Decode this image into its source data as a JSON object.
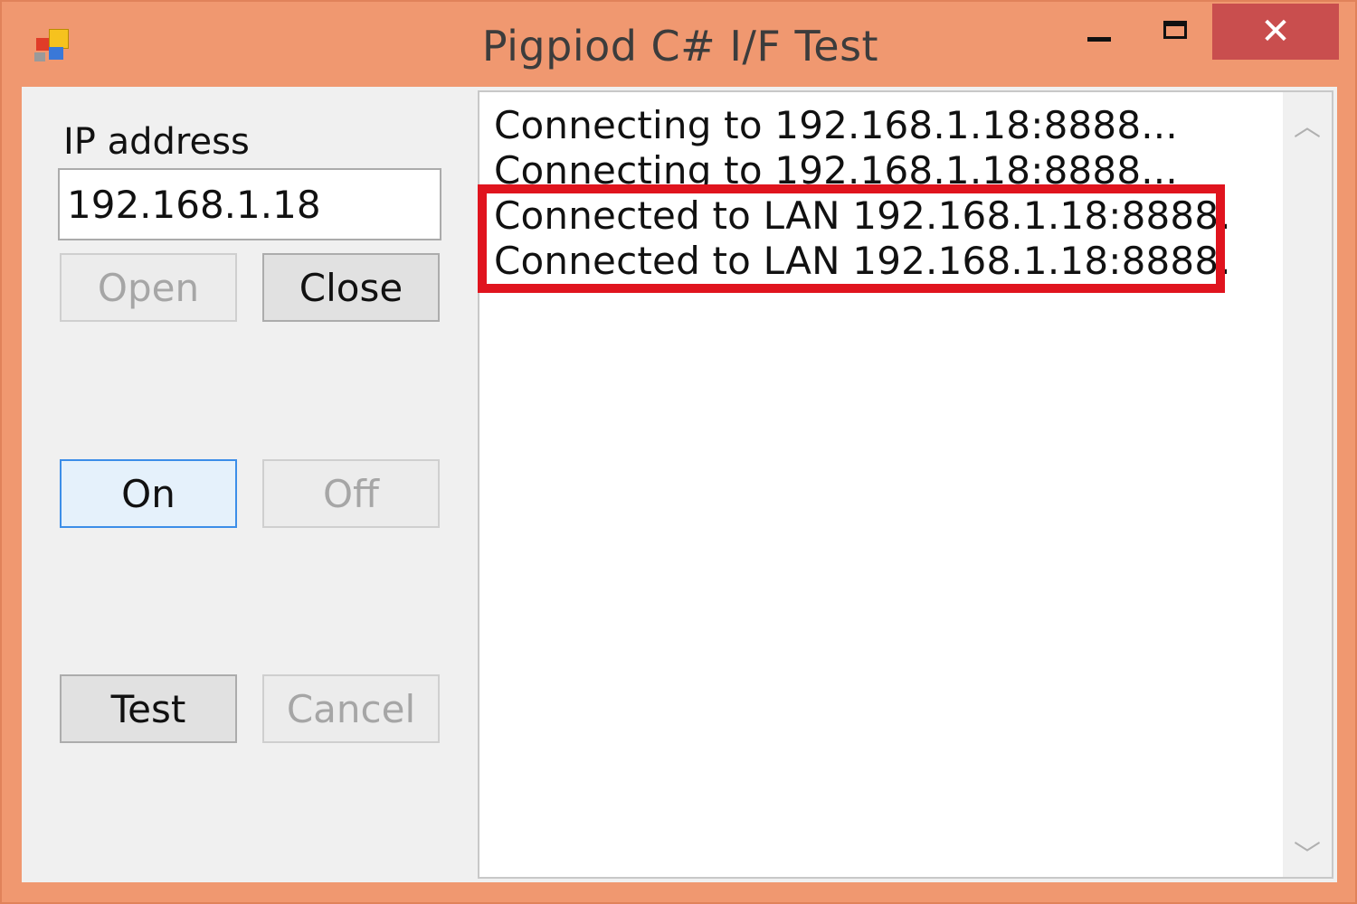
{
  "window": {
    "title": "Pigpiod C# I/F Test",
    "close_glyph": "✕",
    "colors": {
      "frame": "#f09870",
      "close": "#c94e4e",
      "highlight": "#e0141e",
      "focus": "#3c8ee8"
    }
  },
  "form": {
    "ip_label": "IP address",
    "ip_value": "192.168.1.18",
    "buttons": {
      "open": "Open",
      "close": "Close",
      "on": "On",
      "off": "Off",
      "test": "Test",
      "cancel": "Cancel"
    }
  },
  "log": {
    "lines": [
      "Connecting to 192.168.1.18:8888...",
      "Connecting to 192.168.1.18:8888...",
      "Connected to LAN 192.168.1.18:8888.",
      "Connected to LAN 192.168.1.18:8888."
    ]
  },
  "scrollbar": {
    "up_glyph": "︿",
    "down_glyph": "﹀"
  }
}
